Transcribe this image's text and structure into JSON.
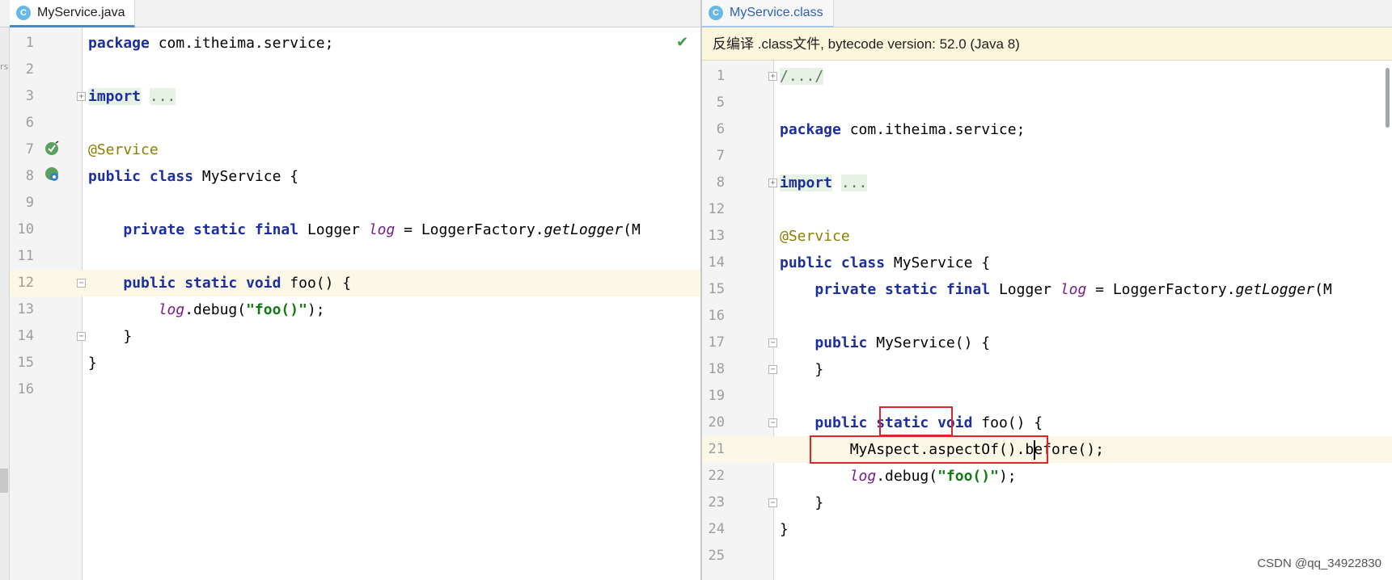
{
  "left_editor": {
    "tab_label": "MyService.java",
    "tab_icon": "C",
    "lines": [
      {
        "n": "1",
        "tokens": [
          {
            "t": "package",
            "c": "kw"
          },
          {
            "t": " com.itheima.service;",
            "c": ""
          }
        ]
      },
      {
        "n": "2",
        "tokens": []
      },
      {
        "n": "3",
        "tokens": [
          {
            "t": "import",
            "c": "fold-txt kw"
          },
          {
            "t": " ",
            "c": ""
          },
          {
            "t": "...",
            "c": "fold-dots"
          }
        ]
      },
      {
        "n": "6",
        "tokens": []
      },
      {
        "n": "7",
        "tokens": [
          {
            "t": "@Service",
            "c": "ann"
          }
        ]
      },
      {
        "n": "8",
        "tokens": [
          {
            "t": "public class",
            "c": "kw"
          },
          {
            "t": " MyService {",
            "c": ""
          }
        ]
      },
      {
        "n": "9",
        "tokens": []
      },
      {
        "n": "10",
        "tokens": [
          {
            "t": "    ",
            "c": ""
          },
          {
            "t": "private static final",
            "c": "kw"
          },
          {
            "t": " Logger ",
            "c": ""
          },
          {
            "t": "log",
            "c": "field"
          },
          {
            "t": " = LoggerFactory.",
            "c": ""
          },
          {
            "t": "getLogger",
            "c": "meth"
          },
          {
            "t": "(M",
            "c": ""
          }
        ]
      },
      {
        "n": "11",
        "tokens": []
      },
      {
        "n": "12",
        "tokens": [
          {
            "t": "    ",
            "c": ""
          },
          {
            "t": "public static void",
            "c": "kw"
          },
          {
            "t": " foo() {",
            "c": ""
          }
        ]
      },
      {
        "n": "13",
        "tokens": [
          {
            "t": "        ",
            "c": ""
          },
          {
            "t": "log",
            "c": "field"
          },
          {
            "t": ".debug(",
            "c": ""
          },
          {
            "t": "\"foo()\"",
            "c": "str"
          },
          {
            "t": ");",
            "c": ""
          }
        ]
      },
      {
        "n": "14",
        "tokens": [
          {
            "t": "    }",
            "c": ""
          }
        ]
      },
      {
        "n": "15",
        "tokens": [
          {
            "t": "}",
            "c": ""
          }
        ]
      },
      {
        "n": "16",
        "tokens": []
      }
    ]
  },
  "right_editor": {
    "tab_label": "MyService.class",
    "tab_icon": "C",
    "banner_text": "反编译 .class文件, bytecode version: 52.0 (Java 8)",
    "lines": [
      {
        "n": "1",
        "tokens": [
          {
            "t": "/.../",
            "c": "fold-dots"
          }
        ]
      },
      {
        "n": "5",
        "tokens": []
      },
      {
        "n": "6",
        "tokens": [
          {
            "t": "package",
            "c": "kw"
          },
          {
            "t": " com.itheima.service;",
            "c": ""
          }
        ]
      },
      {
        "n": "7",
        "tokens": []
      },
      {
        "n": "8",
        "tokens": [
          {
            "t": "import",
            "c": "fold-txt kw"
          },
          {
            "t": " ",
            "c": ""
          },
          {
            "t": "...",
            "c": "fold-dots"
          }
        ]
      },
      {
        "n": "12",
        "tokens": []
      },
      {
        "n": "13",
        "tokens": [
          {
            "t": "@Service",
            "c": "ann"
          }
        ]
      },
      {
        "n": "14",
        "tokens": [
          {
            "t": "public class",
            "c": "kw"
          },
          {
            "t": " MyService {",
            "c": ""
          }
        ]
      },
      {
        "n": "15",
        "tokens": [
          {
            "t": "    ",
            "c": ""
          },
          {
            "t": "private static final",
            "c": "kw"
          },
          {
            "t": " Logger ",
            "c": ""
          },
          {
            "t": "log",
            "c": "field"
          },
          {
            "t": " = LoggerFactory.",
            "c": ""
          },
          {
            "t": "getLogger",
            "c": "meth"
          },
          {
            "t": "(M",
            "c": ""
          }
        ]
      },
      {
        "n": "16",
        "tokens": []
      },
      {
        "n": "17",
        "tokens": [
          {
            "t": "    ",
            "c": ""
          },
          {
            "t": "public",
            "c": "kw"
          },
          {
            "t": " MyService() {",
            "c": ""
          }
        ]
      },
      {
        "n": "18",
        "tokens": [
          {
            "t": "    }",
            "c": ""
          }
        ]
      },
      {
        "n": "19",
        "tokens": []
      },
      {
        "n": "20",
        "tokens": [
          {
            "t": "    ",
            "c": ""
          },
          {
            "t": "public static",
            "c": "kw"
          },
          {
            "t": " ",
            "c": ""
          },
          {
            "t": "void",
            "c": "kw"
          },
          {
            "t": " foo() {",
            "c": ""
          }
        ]
      },
      {
        "n": "21",
        "tokens": [
          {
            "t": "        MyAspect.aspectOf().before();",
            "c": ""
          }
        ]
      },
      {
        "n": "22",
        "tokens": [
          {
            "t": "        ",
            "c": ""
          },
          {
            "t": "log",
            "c": "field"
          },
          {
            "t": ".debug(",
            "c": ""
          },
          {
            "t": "\"foo()\"",
            "c": "str"
          },
          {
            "t": ");",
            "c": ""
          }
        ]
      },
      {
        "n": "23",
        "tokens": [
          {
            "t": "    }",
            "c": ""
          }
        ]
      },
      {
        "n": "24",
        "tokens": [
          {
            "t": "}",
            "c": ""
          }
        ]
      },
      {
        "n": "25",
        "tokens": []
      }
    ]
  },
  "watermark": "CSDN @qq_34922830",
  "colors": {
    "keyword": "#1d2fa0",
    "annotation": "#8b7f00",
    "field": "#7a1d8c",
    "string": "#127a12",
    "highlight_line": "#fcf8e8",
    "red_box": "#e0242b"
  }
}
